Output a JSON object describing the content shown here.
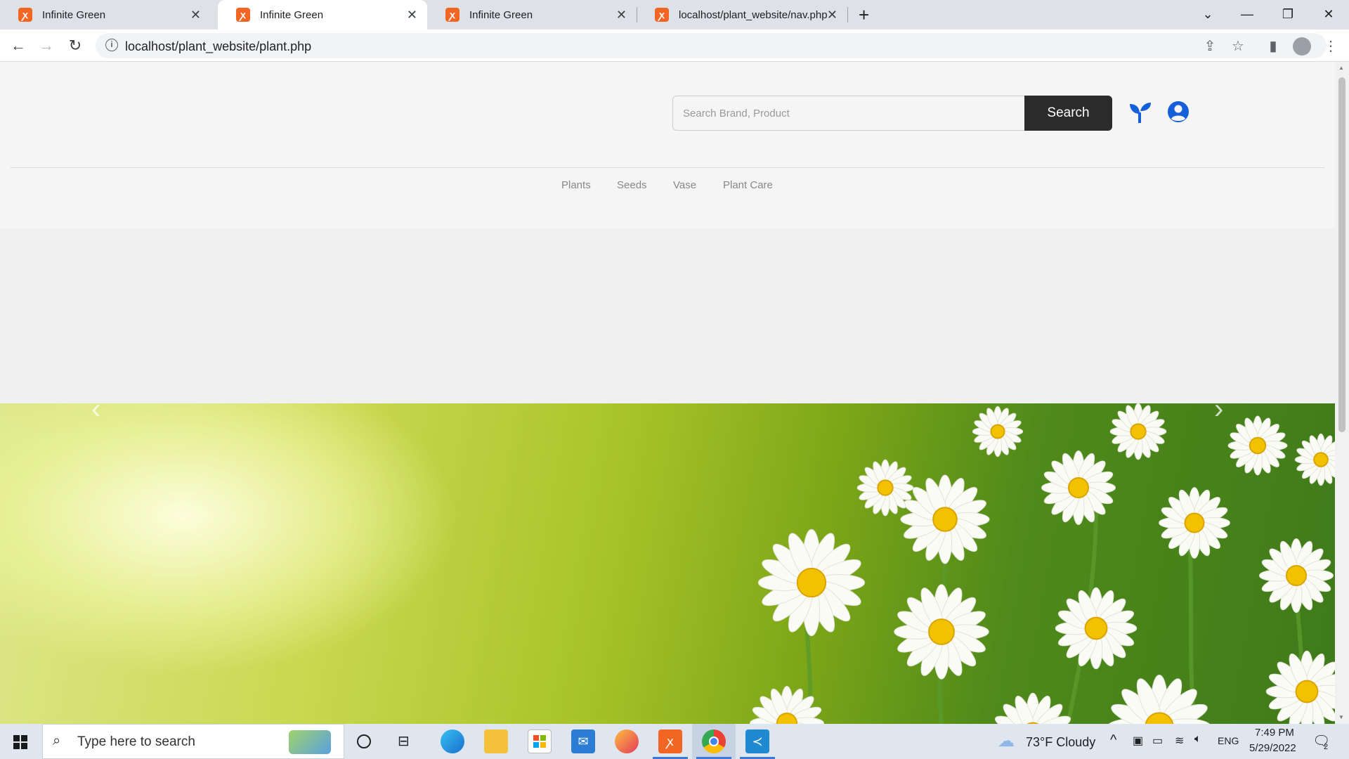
{
  "browser": {
    "tabs": [
      {
        "title": "Infinite Green",
        "active": false
      },
      {
        "title": "Infinite Green",
        "active": true
      },
      {
        "title": "Infinite Green",
        "active": false
      },
      {
        "title": "localhost/plant_website/nav.php",
        "active": false
      }
    ],
    "tab_close_glyph": "✕",
    "new_tab_glyph": "+",
    "url": "localhost/plant_website/plant.php"
  },
  "site": {
    "search": {
      "placeholder": "Search Brand, Product",
      "button_label": "Search"
    },
    "icons": [
      "seedling-icon",
      "user-circle-icon"
    ],
    "accent_color": "#1560d9",
    "nav_links": [
      "Plants",
      "Seeds",
      "Vase",
      "Plant Care"
    ],
    "carousel": {
      "prev_glyph": "‹",
      "next_glyph": "›"
    }
  },
  "taskbar": {
    "search_placeholder": "Type here to search",
    "weather": "73°F  Cloudy",
    "language": "ENG",
    "time": "7:49 PM",
    "date": "5/29/2022",
    "notification_count": "2"
  }
}
